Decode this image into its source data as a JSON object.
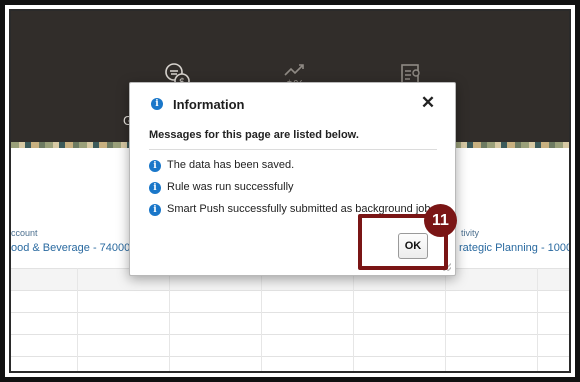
{
  "navbar": {
    "items": [
      {
        "icon": "money-plan-icon",
        "label": "Gr"
      },
      {
        "icon": "percent-trend-icon",
        "label": ""
      },
      {
        "icon": "document-search-icon",
        "label": ""
      }
    ]
  },
  "grid_header": {
    "account_label": "ccount",
    "account_value": "ood & Beverage - 74000",
    "activity_label": "tivity",
    "activity_value": "rategic Planning - 1000"
  },
  "dialog": {
    "title": "Information",
    "close_glyph": "✕",
    "subheading": "Messages for this page are listed below.",
    "messages": [
      "The data has been saved.",
      "Rule was run successfully",
      "Smart Push successfully submitted as background job."
    ],
    "ok_label": "OK",
    "info_glyph": "i"
  },
  "callout": {
    "number": "11",
    "color": "#7a1515"
  }
}
